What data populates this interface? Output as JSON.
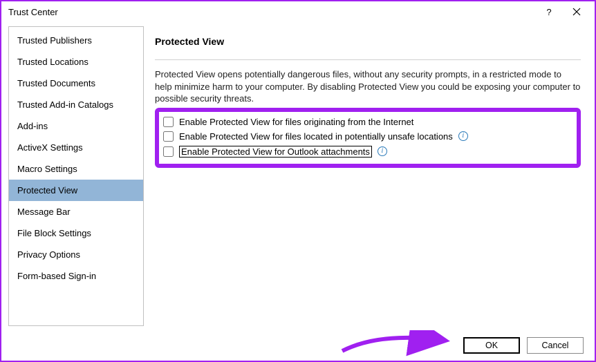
{
  "window": {
    "title": "Trust Center"
  },
  "sidebar": {
    "items": [
      {
        "label": "Trusted Publishers",
        "selected": false
      },
      {
        "label": "Trusted Locations",
        "selected": false
      },
      {
        "label": "Trusted Documents",
        "selected": false
      },
      {
        "label": "Trusted Add-in Catalogs",
        "selected": false
      },
      {
        "label": "Add-ins",
        "selected": false
      },
      {
        "label": "ActiveX Settings",
        "selected": false
      },
      {
        "label": "Macro Settings",
        "selected": false
      },
      {
        "label": "Protected View",
        "selected": true
      },
      {
        "label": "Message Bar",
        "selected": false
      },
      {
        "label": "File Block Settings",
        "selected": false
      },
      {
        "label": "Privacy Options",
        "selected": false
      },
      {
        "label": "Form-based Sign-in",
        "selected": false
      }
    ]
  },
  "main": {
    "section_title": "Protected View",
    "description": "Protected View opens potentially dangerous files, without any security prompts, in a restricted mode to help minimize harm to your computer. By disabling Protected View you could be exposing your computer to possible security threats.",
    "checks": [
      {
        "label": "Enable Protected View for files originating from the Internet",
        "has_info": false,
        "checked": false
      },
      {
        "label": "Enable Protected View for files located in potentially unsafe locations",
        "has_info": true,
        "checked": false
      },
      {
        "label": "Enable Protected View for Outlook attachments",
        "has_info": true,
        "checked": false,
        "focused": true
      }
    ]
  },
  "footer": {
    "ok_label": "OK",
    "cancel_label": "Cancel"
  }
}
